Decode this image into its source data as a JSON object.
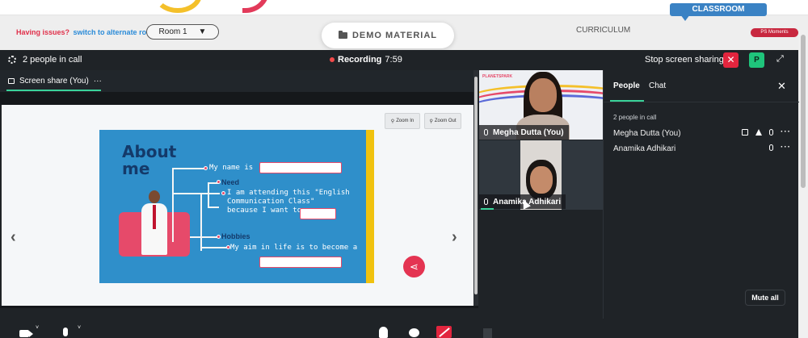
{
  "topbar": {
    "issues_text": "Having issues?",
    "alternate_link": "switch to alternate room",
    "room_label": "Room 1",
    "room_caret": "▼",
    "demo_material": "DEMO MATERIAL",
    "curriculum": "CURRICULUM",
    "classroom": "CLASSROOM",
    "moments": "PS Moments"
  },
  "call": {
    "people_count": "2 people in call",
    "recording_label": "Recording",
    "recording_time": "7:59",
    "stop_sharing": "Stop screen sharing",
    "stop_icon": "✕",
    "avatar_letter": "P",
    "expand_icon": "⤢"
  },
  "share": {
    "tab_label": "Screen share (You)",
    "more": "···",
    "zoom_in": "Zoom In",
    "zoom_out": "Zoom Out",
    "prev": "‹",
    "next": "›",
    "share_icon": "⋖"
  },
  "slide": {
    "title_line1": "About",
    "title_line2": "me",
    "my_name": "My name is",
    "need": "Need",
    "attending_1": "I am attending this \"English",
    "attending_2": "Communication Class\"",
    "attending_3": "because I want to",
    "hobbies": "Hobbies",
    "aim": "My aim in life is to become a"
  },
  "participants_video": [
    {
      "name": "Megha Dutta (You)",
      "logo": "PLANETSPARK"
    },
    {
      "name": "Anamika Adhikari"
    }
  ],
  "panel": {
    "tab_people": "People",
    "tab_chat": "Chat",
    "close": "✕",
    "people_in_call": "2 people in call",
    "people": [
      {
        "name": "Megha Dutta (You)"
      },
      {
        "name": "Anamika Adhikari"
      }
    ],
    "more": "···",
    "mute_all": "Mute all"
  },
  "bottom": {
    "chevron": "˅"
  },
  "colors": {
    "accent_green": "#3ad39a",
    "danger_red": "#e2253e",
    "dark_bg": "#1f2327",
    "slide_blue": "#2f8fca"
  }
}
